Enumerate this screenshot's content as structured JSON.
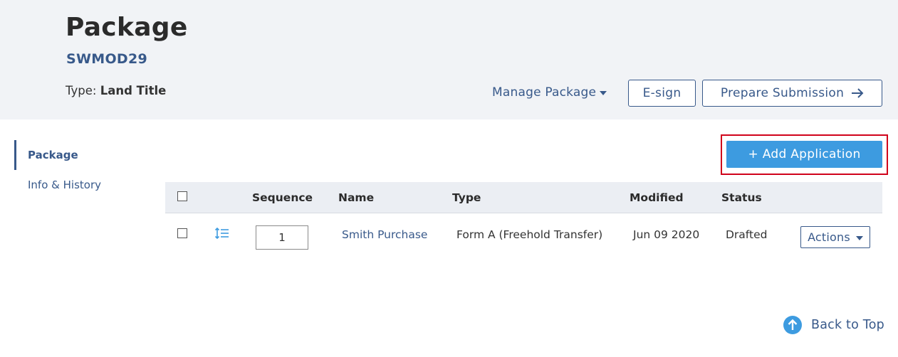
{
  "header": {
    "title": "Package",
    "package_id": "SWMOD29",
    "type_label": "Type:",
    "type_value": "Land Title",
    "manage_label": "Manage Package",
    "esign_label": "E-sign",
    "prepare_label": "Prepare Submission"
  },
  "sidebar": {
    "items": [
      {
        "label": "Package",
        "active": true
      },
      {
        "label": "Info & History",
        "active": false
      }
    ]
  },
  "main": {
    "add_button_label": "+ Add Application",
    "table": {
      "headers": {
        "sequence": "Sequence",
        "name": "Name",
        "type": "Type",
        "modified": "Modified",
        "status": "Status"
      },
      "rows": [
        {
          "sequence": "1",
          "name": "Smith Purchase",
          "type": "Form A (Freehold Transfer)",
          "modified": "Jun 09 2020",
          "status": "Drafted",
          "actions_label": "Actions"
        }
      ]
    }
  },
  "footer": {
    "back_to_top_label": "Back to Top"
  },
  "colors": {
    "brand": "#38598a",
    "primary_button": "#3d9be0",
    "header_bg": "#f1f3f6",
    "highlight": "#d0021b"
  },
  "icons": {
    "manage_caret": "chevron-down-icon",
    "prepare_arrow": "arrow-right-icon",
    "reorder": "reorder-icon",
    "actions_caret": "chevron-down-icon",
    "back_to_top": "arrow-up-circle-icon"
  }
}
